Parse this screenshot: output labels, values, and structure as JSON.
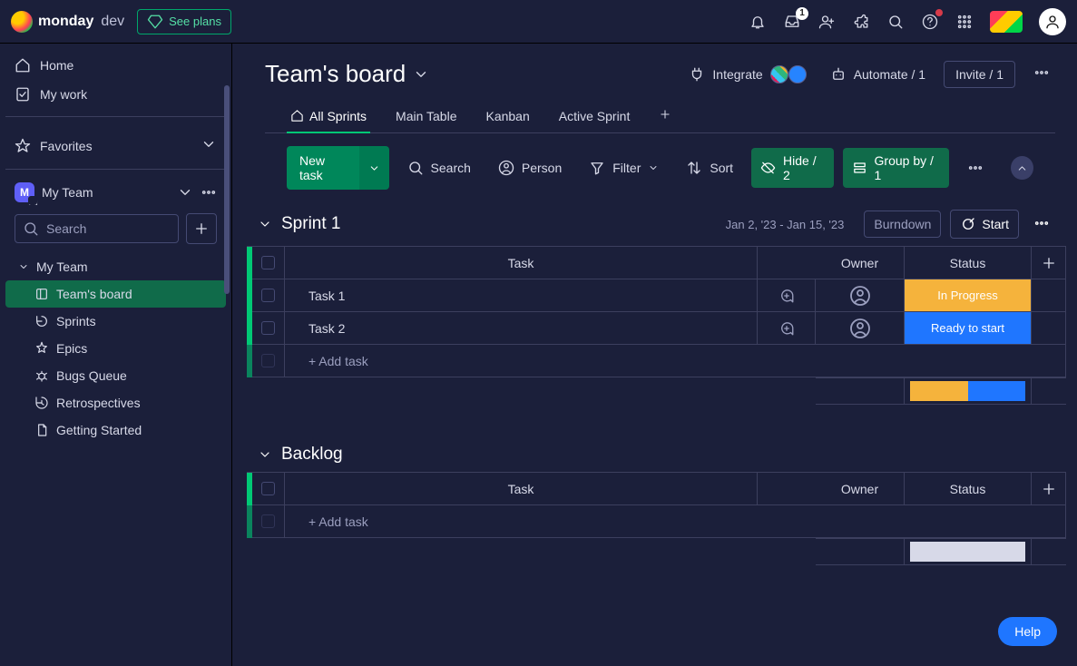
{
  "topbar": {
    "brand": "monday",
    "product": "dev",
    "see_plans": "See plans",
    "inbox_badge": "1"
  },
  "sidebar": {
    "home": "Home",
    "my_work": "My work",
    "favorites": "Favorites",
    "workspace_name": "My Team",
    "workspace_initial": "M",
    "search_placeholder": "Search",
    "tree": {
      "root": "My Team",
      "items": [
        {
          "label": "Team's board",
          "active": true
        },
        {
          "label": "Sprints"
        },
        {
          "label": "Epics"
        },
        {
          "label": "Bugs Queue"
        },
        {
          "label": "Retrospectives"
        },
        {
          "label": "Getting Started"
        }
      ]
    }
  },
  "board": {
    "title": "Team's board",
    "integrate": "Integrate",
    "automate": "Automate / 1",
    "invite": "Invite / 1",
    "tabs": [
      {
        "label": "All Sprints",
        "active": true,
        "icon": "home"
      },
      {
        "label": "Main Table"
      },
      {
        "label": "Kanban"
      },
      {
        "label": "Active Sprint"
      }
    ],
    "toolbar": {
      "new_task": "New task",
      "search": "Search",
      "person": "Person",
      "filter": "Filter",
      "sort": "Sort",
      "hide": "Hide / 2",
      "group_by": "Group by / 1"
    },
    "groups": [
      {
        "name": "Sprint 1",
        "date_range": "Jan 2, '23 - Jan 15, '23",
        "burndown": "Burndown",
        "start": "Start",
        "columns": [
          "Task",
          "Owner",
          "Status"
        ],
        "rows": [
          {
            "task": "Task 1",
            "status": {
              "label": "In Progress",
              "class": "status-in-progress"
            }
          },
          {
            "task": "Task 2",
            "status": {
              "label": "Ready to start",
              "class": "status-ready"
            }
          }
        ],
        "add_task": "+ Add task",
        "status_split": [
          {
            "class": "inpr"
          },
          {
            "class": "ready"
          }
        ]
      },
      {
        "name": "Backlog",
        "columns": [
          "Task",
          "Owner",
          "Status"
        ],
        "rows": [],
        "add_task": "+ Add task",
        "status_placeholder": true
      }
    ]
  },
  "help": "Help"
}
